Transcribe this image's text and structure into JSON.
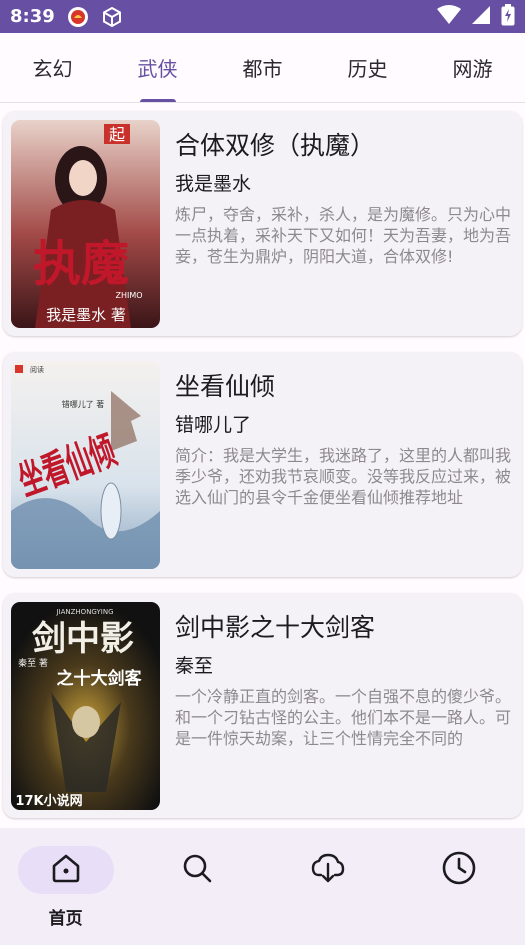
{
  "status_bar": {
    "time": "8:39",
    "icons": [
      "app-notification-icon",
      "package-icon",
      "wifi-icon",
      "signal-icon",
      "battery-charging-icon"
    ]
  },
  "tabs": [
    {
      "label": "玄幻",
      "active": false
    },
    {
      "label": "武侠",
      "active": true
    },
    {
      "label": "都市",
      "active": false
    },
    {
      "label": "历史",
      "active": false
    },
    {
      "label": "网游",
      "active": false
    }
  ],
  "books": [
    {
      "title": "合体双修（执魔）",
      "author": "我是墨水",
      "description": "炼尸，夺舍，采补，杀人，是为魔修。只为心中一点执着，采补天下又如何！天为吾妻，地为吾妾，苍生为鼎炉，阴阳大道，合体双修!",
      "cover": {
        "title_text": "执魔",
        "sub_text": "ZHIMO",
        "author_text": "我是墨水 著",
        "badge": "起"
      }
    },
    {
      "title": "坐看仙倾",
      "author": "错哪儿了",
      "description": "简介：我是大学生，我迷路了，这里的人都叫我季少爷，还劝我节哀顺变。没等我反应过来，被选入仙门的县令千金便坐看仙倾推荐地址",
      "cover": {
        "title_text": "坐看仙倾",
        "sub_text": "错哪儿了 著",
        "badge": "阅读"
      }
    },
    {
      "title": "剑中影之十大剑客",
      "author": "秦至",
      "description": "一个冷静正直的剑客。一个自强不息的傻少爷。和一个刁钻古怪的公主。他们本不是一路人。可是一件惊天劫案，让三个性情完全不同的",
      "cover": {
        "title_text": "剑中影",
        "subtitle_text": "之十大剑客",
        "sub_text": "JIANZHONGYING",
        "author_text": "秦至 著",
        "site_text": "17K小说网"
      }
    }
  ],
  "bottom_nav": [
    {
      "label": "首页",
      "icon": "home-icon",
      "active": true
    },
    {
      "label": "",
      "icon": "search-icon",
      "active": false
    },
    {
      "label": "",
      "icon": "download-icon",
      "active": false
    },
    {
      "label": "",
      "icon": "history-icon",
      "active": false
    }
  ],
  "colors": {
    "primary": "#6750a4",
    "nav_active_pill": "#e8def8",
    "card_bg": "#f5f2f7"
  }
}
